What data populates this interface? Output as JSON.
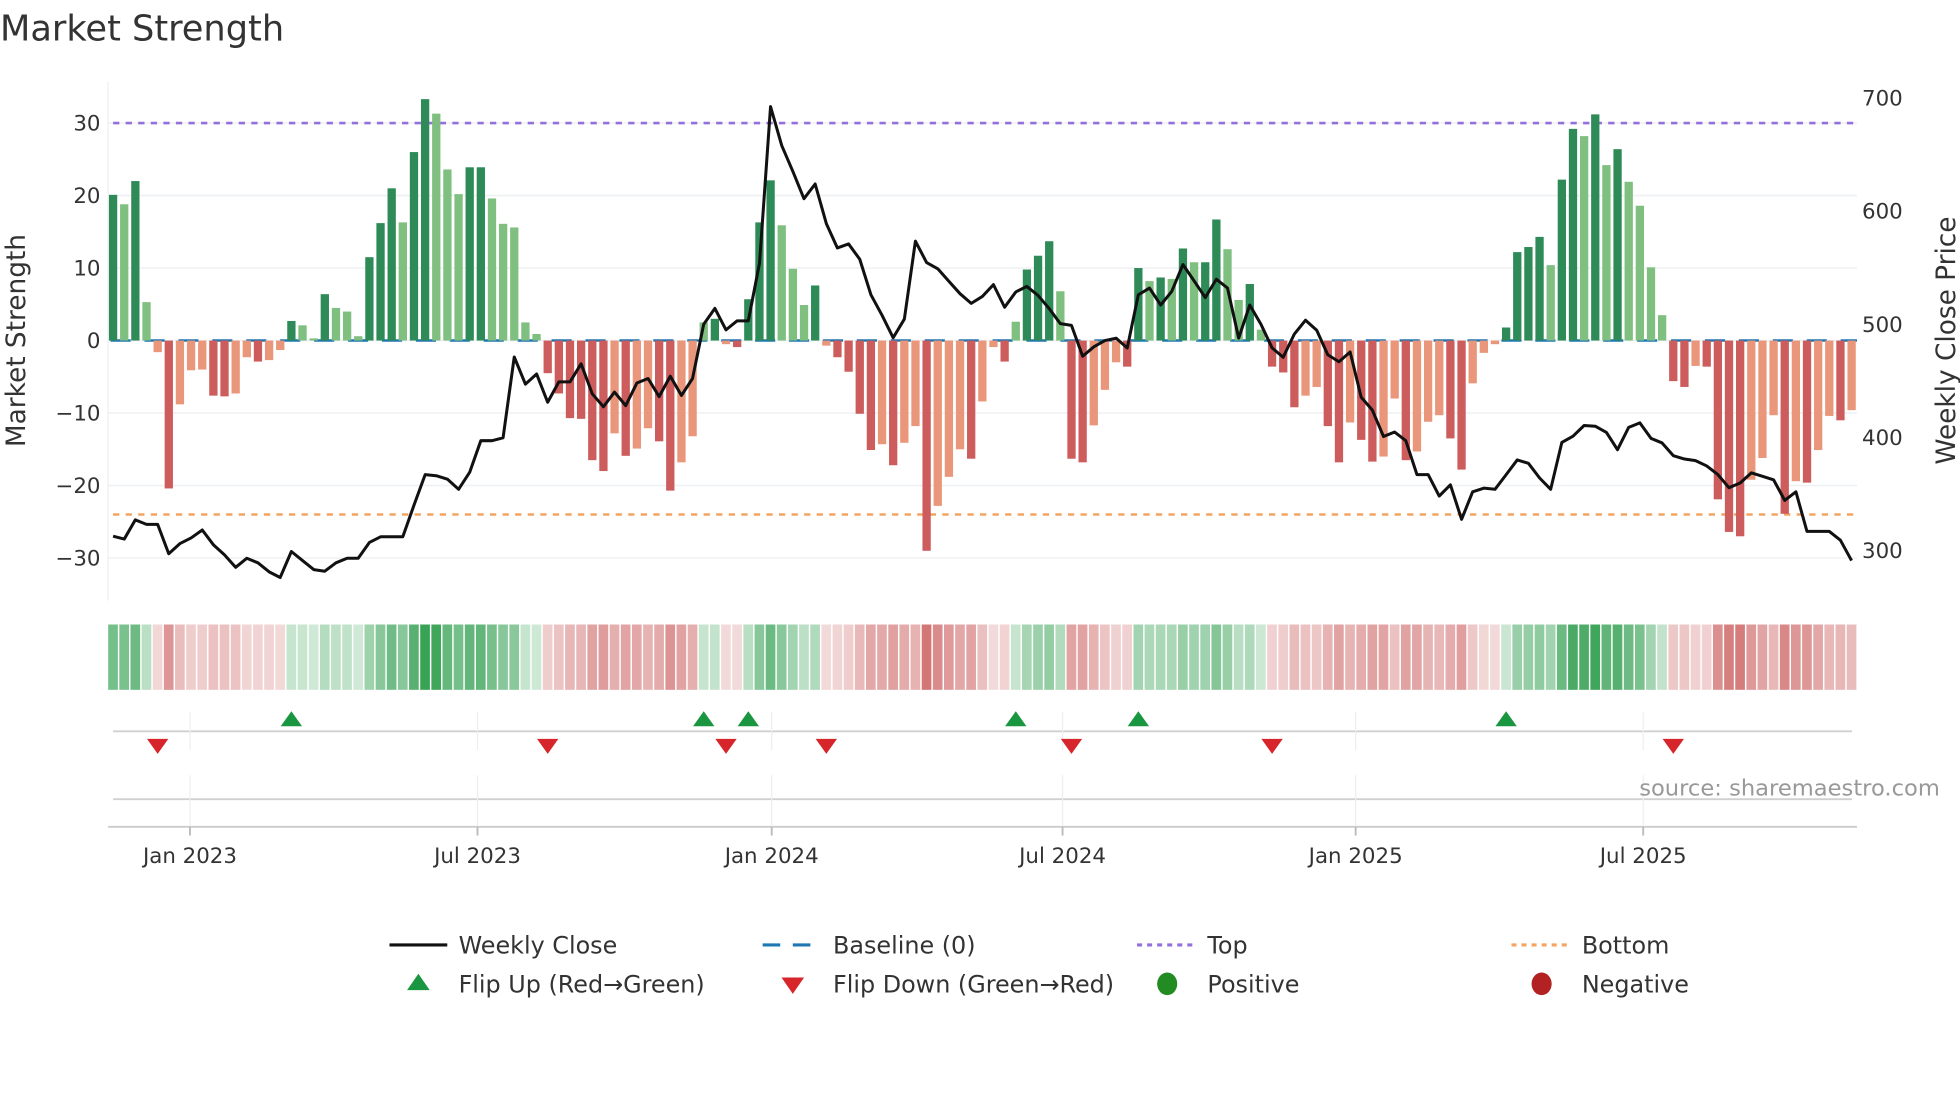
{
  "title": "Market Strength",
  "source": "source: sharemaestro.com",
  "colors": {
    "pos_strong": "#2e8b57",
    "pos_weak": "#7fbf7f",
    "neg_strong": "#cd5c5c",
    "neg_weak": "#e9967a",
    "close": "#111111",
    "baseline": "#1f77b4",
    "top": "#9370db",
    "bottom": "#f4a460",
    "flip_up": "#1a9641",
    "flip_down": "#d7262b",
    "positive_dot": "#228b22",
    "negative_dot": "#b22222"
  },
  "legend": {
    "weekly_close": "Weekly Close",
    "baseline": "Baseline (0)",
    "top": "Top",
    "bottom": "Bottom",
    "flip_up": "Flip Up (Red→Green)",
    "flip_down": "Flip Down (Green→Red)",
    "positive": "Positive",
    "negative": "Negative"
  },
  "chart_data": {
    "type": "bar",
    "title": "Market Strength",
    "ylabel": "Market Strength",
    "y2label": "Weekly Close Price",
    "ylim": [
      -35,
      35
    ],
    "y2lim": [
      280,
      715
    ],
    "yticks": [
      "30",
      "20",
      "10",
      "0",
      "−10",
      "−20",
      "−30"
    ],
    "ytick_values": [
      30,
      20,
      10,
      0,
      -10,
      -20,
      -30
    ],
    "y2ticks": [
      "700",
      "600",
      "500",
      "400",
      "300"
    ],
    "y2tick_values": [
      700,
      600,
      500,
      400,
      300
    ],
    "xticks": [
      "Jan 2023",
      "Jul 2023",
      "Jan 2024",
      "Jul 2024",
      "Jan 2025",
      "Jul 2025"
    ],
    "xtick_weeks": [
      7.9,
      33.7,
      60.1,
      86.2,
      112.5,
      138.3
    ],
    "top_level": 30,
    "bottom_level": -24,
    "baseline": 0,
    "grid": true,
    "legend_position": "bottom",
    "x_unit": "week",
    "strength": [
      20.1,
      18.8,
      22.0,
      5.3,
      -1.6,
      -20.4,
      -8.8,
      -4.1,
      -4.0,
      -7.6,
      -7.7,
      -7.3,
      -2.3,
      -2.9,
      -2.7,
      -1.3,
      2.7,
      2.1,
      0.3,
      6.4,
      4.5,
      4.0,
      0.6,
      11.5,
      16.2,
      21.0,
      16.3,
      26.0,
      33.3,
      31.3,
      23.6,
      20.2,
      23.9,
      23.9,
      19.6,
      16.1,
      15.6,
      2.5,
      0.9,
      -4.5,
      -7.3,
      -10.7,
      -10.8,
      -16.5,
      -18.0,
      -12.8,
      -15.9,
      -14.9,
      -12.1,
      -13.9,
      -20.7,
      -16.8,
      -13.2,
      2.5,
      3.0,
      -0.5,
      -0.9,
      5.7,
      16.3,
      22.1,
      15.9,
      9.9,
      4.9,
      7.6,
      -0.7,
      -2.3,
      -4.3,
      -10.1,
      -15.1,
      -14.3,
      -17.2,
      -14.1,
      -11.8,
      -29.0,
      -22.8,
      -18.8,
      -15.0,
      -16.3,
      -8.4,
      -0.9,
      -2.9,
      2.6,
      9.8,
      11.7,
      13.7,
      6.8,
      -16.3,
      -16.8,
      -11.7,
      -6.8,
      -3.0,
      -3.6,
      10.0,
      8.2,
      8.7,
      8.5,
      12.7,
      10.8,
      10.8,
      16.7,
      12.6,
      5.6,
      7.8,
      1.5,
      -3.6,
      -4.4,
      -9.2,
      -7.6,
      -6.4,
      -11.8,
      -16.8,
      -11.3,
      -13.7,
      -16.7,
      -16.0,
      -8.0,
      -16.5,
      -15.3,
      -11.2,
      -10.3,
      -13.5,
      -17.8,
      -5.9,
      -1.7,
      -0.5,
      1.8,
      12.2,
      12.9,
      14.3,
      10.4,
      22.2,
      29.2,
      28.2,
      31.2,
      24.2,
      26.4,
      21.9,
      18.6,
      10.1,
      3.5,
      -5.6,
      -6.4,
      -3.5,
      -3.6,
      -21.9,
      -26.4,
      -27.0,
      -19.2,
      -16.2,
      -10.3,
      -23.9,
      -19.4,
      -19.6,
      -15.1,
      -10.4,
      -11.0,
      -9.6
    ],
    "weekly_close": [
      312.6,
      310,
      327,
      323,
      323,
      297,
      306,
      311,
      318,
      305,
      296,
      285,
      293,
      289,
      281,
      276,
      299,
      291,
      283,
      281.5,
      289,
      293,
      293,
      307,
      312,
      312,
      312,
      340,
      367,
      366,
      363,
      354,
      369,
      397,
      397,
      399.5,
      471,
      447,
      456,
      431,
      449,
      449,
      465,
      438.5,
      427,
      440,
      428,
      448,
      452,
      436,
      454,
      437,
      452,
      500,
      514,
      495,
      503,
      503,
      554,
      692.5,
      658,
      635,
      611,
      624,
      589,
      567.5,
      571,
      557.5,
      526,
      508,
      488,
      504.5,
      573.4,
      554.6,
      549,
      538,
      527,
      518.4,
      524.5,
      535,
      515,
      528.5,
      533.4,
      525.4,
      513.8,
      500.6,
      499,
      471.7,
      480,
      485.5,
      487.7,
      479,
      526,
      532,
      517,
      529,
      552.8,
      538.3,
      523.6,
      539.8,
      532,
      487.7,
      517,
      500,
      479,
      470.8,
      491.3,
      503.6,
      494.7,
      473,
      466.8,
      475.4,
      435.4,
      424,
      400.7,
      404.7,
      397,
      367,
      367,
      348,
      358,
      327.4,
      351.8,
      355,
      354,
      367,
      380,
      377,
      364,
      354,
      395.4,
      401,
      410.4,
      409.8,
      404.3,
      389,
      408.8,
      412.8,
      399,
      395,
      383.8,
      380.8,
      379.3,
      374.7,
      367,
      355.5,
      359.5,
      368.6,
      365.5,
      362.5,
      344.2,
      351.8,
      316.8,
      316.8,
      316.8,
      309,
      291
    ],
    "flip_up_weeks": [
      17,
      54,
      58,
      82,
      93,
      126
    ],
    "flip_down_weeks": [
      5,
      40,
      56,
      65,
      87,
      105,
      141
    ]
  }
}
